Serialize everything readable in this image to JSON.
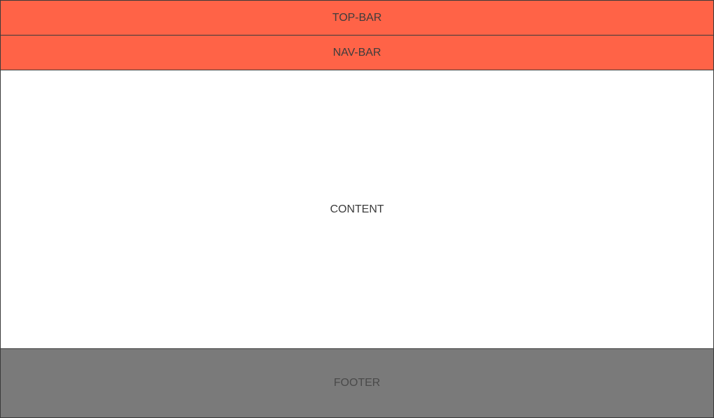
{
  "layout": {
    "top_bar": {
      "label": "TOP-BAR"
    },
    "nav_bar": {
      "label": "NAV-BAR"
    },
    "content": {
      "label": "CONTENT"
    },
    "footer": {
      "label": "FOOTER"
    }
  },
  "colors": {
    "bar": "#ff6347",
    "content": "#ffffff",
    "footer": "#7a7a7a",
    "border": "#3a3a3a",
    "text": "#3c3c3c"
  }
}
